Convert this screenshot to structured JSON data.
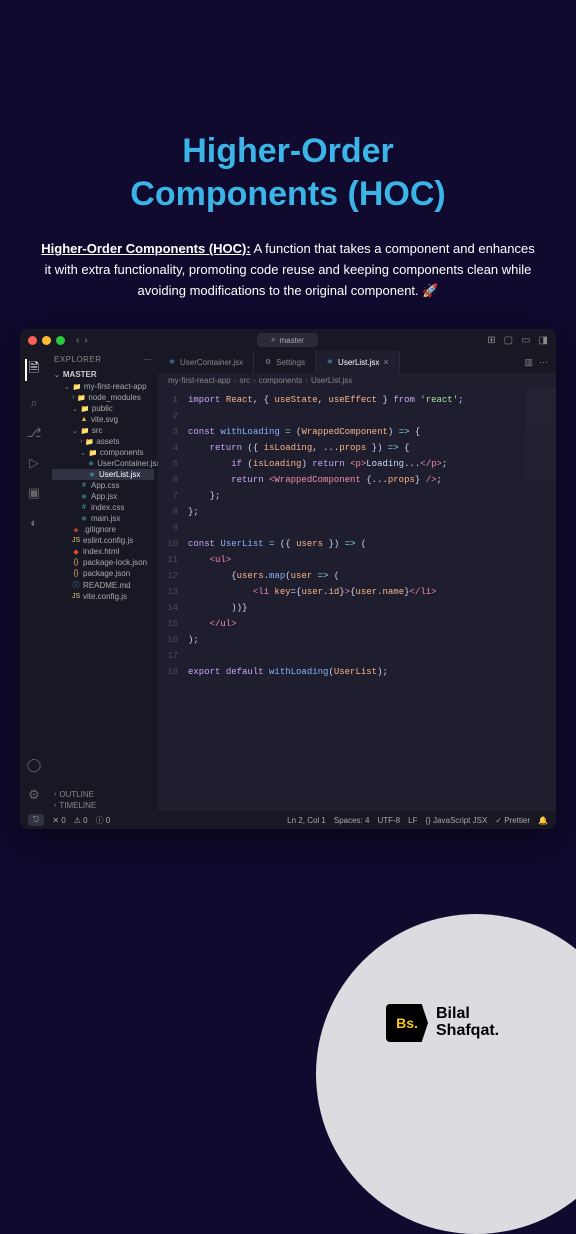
{
  "title_line1": "Higher-Order",
  "title_line2": "Components (HOC)",
  "description_lead": "Higher-Order Components (HOC):",
  "description_rest": " A function that takes a component and enhances it with extra functionality, promoting code reuse and keeping components clean while avoiding modifications to the original component. 🚀",
  "vscode": {
    "branch": "master",
    "explorer_label": "EXPLORER",
    "workspace": "MASTER",
    "tree": [
      {
        "depth": 1,
        "icon": "folder",
        "chev": "⌄",
        "label": "my-first-react-app"
      },
      {
        "depth": 2,
        "icon": "folder",
        "chev": "›",
        "label": "node_modules"
      },
      {
        "depth": 2,
        "icon": "folder",
        "chev": "⌄",
        "label": "public"
      },
      {
        "depth": 3,
        "icon": "svg",
        "label": "vite.svg"
      },
      {
        "depth": 2,
        "icon": "folder",
        "chev": "⌄",
        "label": "src"
      },
      {
        "depth": 3,
        "icon": "folder",
        "chev": "›",
        "label": "assets"
      },
      {
        "depth": 3,
        "icon": "folder",
        "chev": "⌄",
        "label": "components"
      },
      {
        "depth": 4,
        "icon": "react",
        "label": "UserContainer.jsx"
      },
      {
        "depth": 4,
        "icon": "react",
        "label": "UserList.jsx",
        "selected": true
      },
      {
        "depth": 3,
        "icon": "css",
        "label": "App.css"
      },
      {
        "depth": 3,
        "icon": "react",
        "label": "App.jsx"
      },
      {
        "depth": 3,
        "icon": "css",
        "label": "index.css"
      },
      {
        "depth": 3,
        "icon": "react",
        "label": "main.jsx"
      },
      {
        "depth": 2,
        "icon": "git",
        "label": ".gitignore"
      },
      {
        "depth": 2,
        "icon": "js",
        "label": "eslint.config.js"
      },
      {
        "depth": 2,
        "icon": "html",
        "label": "index.html"
      },
      {
        "depth": 2,
        "icon": "json",
        "label": "package-lock.json"
      },
      {
        "depth": 2,
        "icon": "json",
        "label": "package.json"
      },
      {
        "depth": 2,
        "icon": "md",
        "label": "README.md"
      },
      {
        "depth": 2,
        "icon": "js",
        "label": "vite.config.js"
      }
    ],
    "outline": "OUTLINE",
    "timeline": "TIMELINE",
    "tabs": [
      {
        "icon": "react",
        "label": "UserContainer.jsx"
      },
      {
        "icon": "gear",
        "label": "Settings"
      },
      {
        "icon": "react",
        "label": "UserList.jsx",
        "active": true
      }
    ],
    "breadcrumb": [
      "my-first-react-app",
      "src",
      "components",
      "UserList.jsx"
    ],
    "code_lines": 18,
    "status": {
      "errors": "0",
      "warnings": "0",
      "hints": "0",
      "ln": "Ln 2, Col 1",
      "spaces": "Spaces: 4",
      "enc": "UTF-8",
      "eol": "LF",
      "lang": "JavaScript JSX",
      "prettier": "Prettier"
    }
  },
  "brand": {
    "badge": "Bs.",
    "line1": "Bilal",
    "line2": "Shafqat."
  }
}
